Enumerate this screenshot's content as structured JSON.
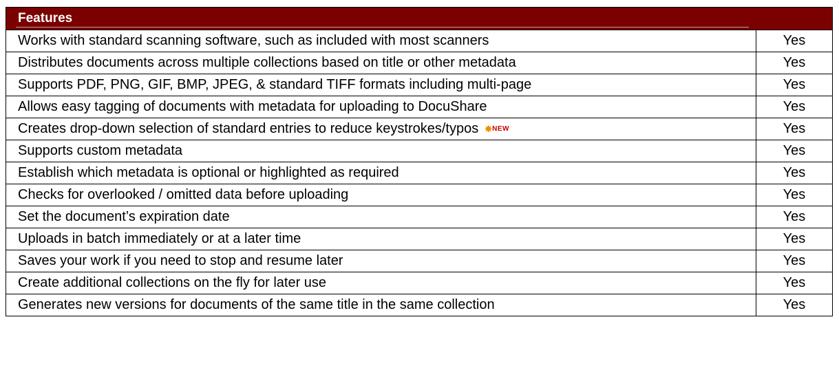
{
  "header": {
    "title": "Features"
  },
  "rows": [
    {
      "feature": "Works with standard scanning software, such as included with most scanners",
      "value": "Yes"
    },
    {
      "feature": "Distributes documents across multiple collections based on title or other metadata",
      "value": "Yes"
    },
    {
      "feature": "Supports PDF, PNG, GIF, BMP, JPEG, & standard TIFF formats including multi-page",
      "value": "Yes"
    },
    {
      "feature": "Allows easy tagging of documents with metadata for uploading to DocuShare",
      "value": "Yes"
    },
    {
      "feature": "Creates drop-down selection of standard entries to reduce keystrokes/typos",
      "value": "Yes",
      "badge": "NEW"
    },
    {
      "feature": "Supports custom metadata",
      "value": "Yes"
    },
    {
      "feature": "Establish which metadata is optional or highlighted as required",
      "value": "Yes"
    },
    {
      "feature": "Checks for overlooked / omitted data before uploading",
      "value": "Yes"
    },
    {
      "feature": "Set the document’s expiration date",
      "value": "Yes"
    },
    {
      "feature": "Uploads in batch immediately or at a later time",
      "value": "Yes"
    },
    {
      "feature": "Saves your work if you need to stop and resume later",
      "value": "Yes"
    },
    {
      "feature": "Create additional collections on the fly for later use",
      "value": "Yes"
    },
    {
      "feature": "Generates new versions for documents of the same title in the same collection",
      "value": "Yes"
    }
  ],
  "colors": {
    "header_background": "#7b0000",
    "header_text": "#ffffff",
    "badge_star": "#f28c00",
    "badge_text": "#c40000"
  }
}
